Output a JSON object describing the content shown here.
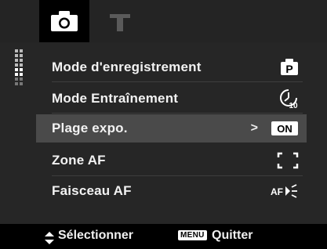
{
  "tabs": [
    {
      "icon": "camera-icon",
      "active": true
    },
    {
      "icon": "wrench-icon",
      "active": false
    }
  ],
  "menu": {
    "items": [
      {
        "label": "Mode d'enregistrement",
        "icon": "record-mode-p-icon",
        "value_text": "P"
      },
      {
        "label": "Mode Entraînement",
        "icon": "self-timer-10s-icon"
      },
      {
        "label": "Plage expo.",
        "icon": "on-badge-icon",
        "value_text": "ON",
        "selected": true,
        "arrow": ">"
      },
      {
        "label": "Zone AF",
        "icon": "af-zone-brackets-icon"
      },
      {
        "label": "Faisceau AF",
        "icon": "af-assist-beam-icon",
        "value_text": "AF"
      }
    ]
  },
  "footer": {
    "select_label": "Sélectionner",
    "menu_key": "MENU",
    "quit_label": "Quitter"
  },
  "colors": {
    "panel": "#262626",
    "selected_row": "#4a4a4a",
    "tabbar": "#242424",
    "text": "#f2f2f2"
  }
}
